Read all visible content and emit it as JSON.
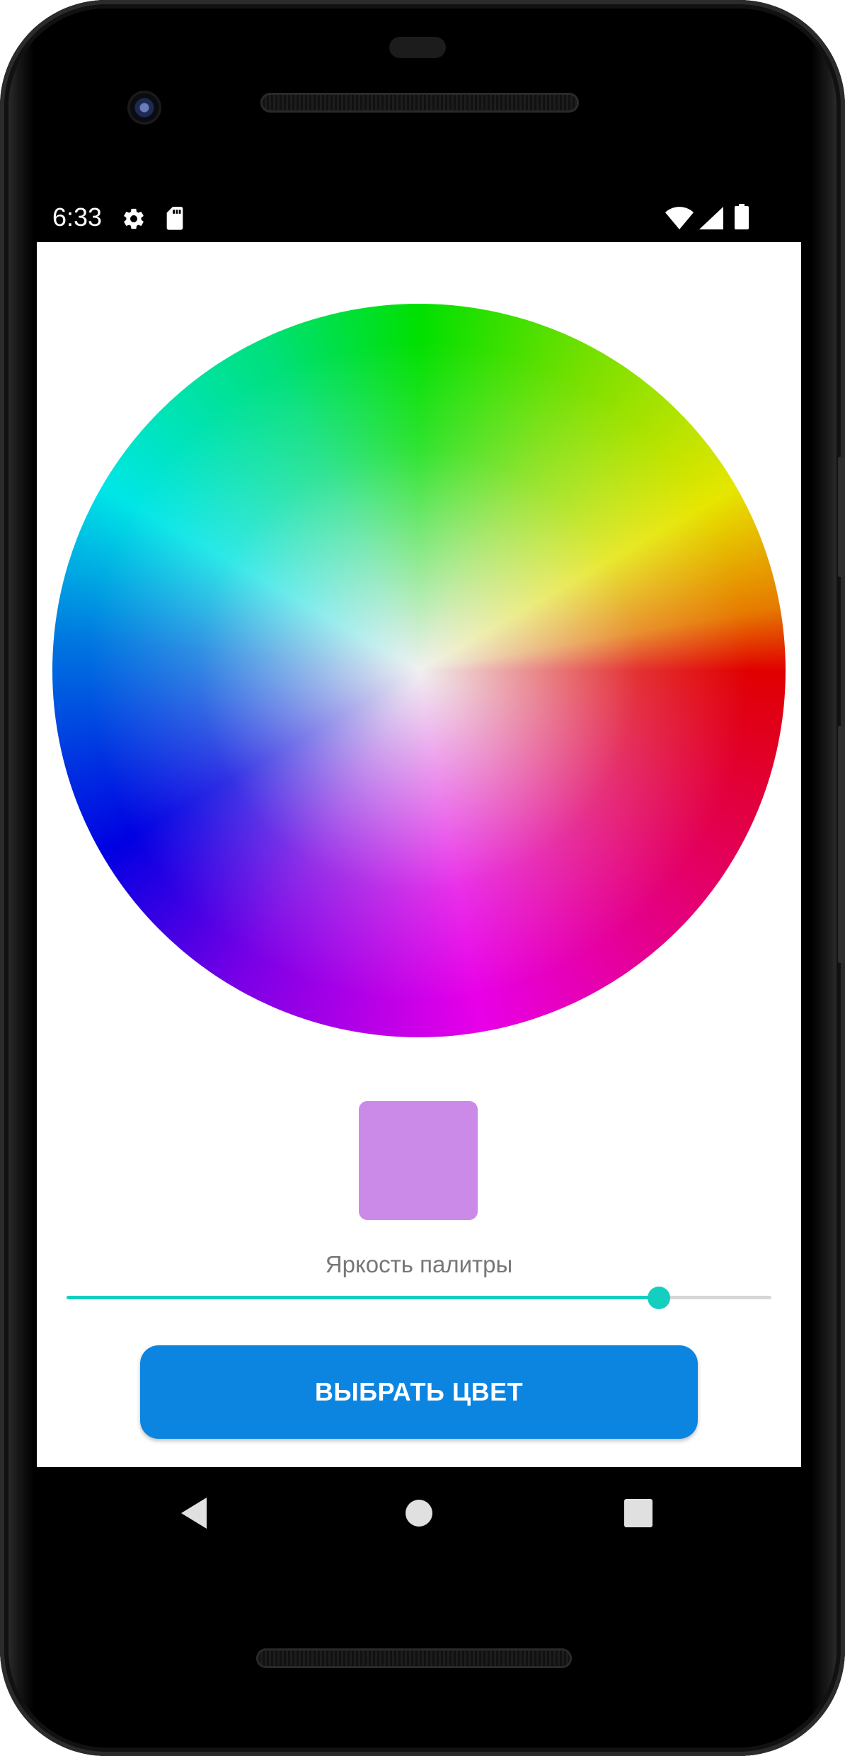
{
  "status_bar": {
    "time": "6:33",
    "left_icons": [
      "settings-gear-icon",
      "sd-card-icon"
    ],
    "right_icons": [
      "wifi-icon",
      "cell-signal-icon",
      "battery-icon"
    ]
  },
  "color_wheel": {
    "type": "hue-saturation-wheel"
  },
  "preview": {
    "color": "#cc8ae8"
  },
  "brightness": {
    "label": "Яркость палитры",
    "value": 0.84,
    "accent_color": "#14cfc0"
  },
  "action_button": {
    "label": "ВЫБРАТЬ ЦВЕТ",
    "color": "#0c85e0"
  },
  "nav_bar": {
    "buttons": [
      "back-icon",
      "home-icon",
      "recents-icon"
    ]
  }
}
